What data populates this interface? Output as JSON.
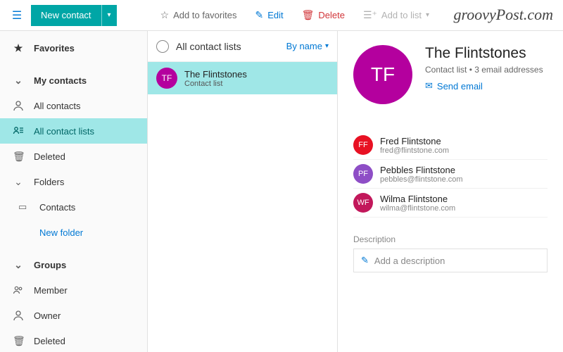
{
  "toolbar": {
    "new_contact": "New contact",
    "add_favorites": "Add to favorites",
    "edit": "Edit",
    "delete": "Delete",
    "add_to_list": "Add to list"
  },
  "watermark": "groovyPost.com",
  "sidebar": {
    "favorites": "Favorites",
    "my_contacts": "My contacts",
    "all_contacts": "All contacts",
    "all_contact_lists": "All contact lists",
    "deleted": "Deleted",
    "folders": "Folders",
    "contacts_folder": "Contacts",
    "new_folder": "New folder",
    "groups": "Groups",
    "member": "Member",
    "owner": "Owner",
    "groups_deleted": "Deleted"
  },
  "list": {
    "title": "All contact lists",
    "sort": "By name",
    "items": [
      {
        "initials": "TF",
        "name": "The Flintstones",
        "sub": "Contact list",
        "color": "#b4009e"
      }
    ]
  },
  "detail": {
    "initials": "TF",
    "color": "#b4009e",
    "title": "The Flintstones",
    "subtitle": "Contact list • 3 email addresses",
    "send_email": "Send email",
    "members": [
      {
        "initials": "FF",
        "name": "Fred Flintstone",
        "email": "fred@flintstone.com",
        "color": "#e81123"
      },
      {
        "initials": "PF",
        "name": "Pebbles Flintstone",
        "email": "pebbles@flintstone.com",
        "color": "#8e4ec6"
      },
      {
        "initials": "WF",
        "name": "Wilma Flintstone",
        "email": "wilma@flintstone.com",
        "color": "#c2185b"
      }
    ],
    "desc_label": "Description",
    "desc_placeholder": "Add a description"
  }
}
